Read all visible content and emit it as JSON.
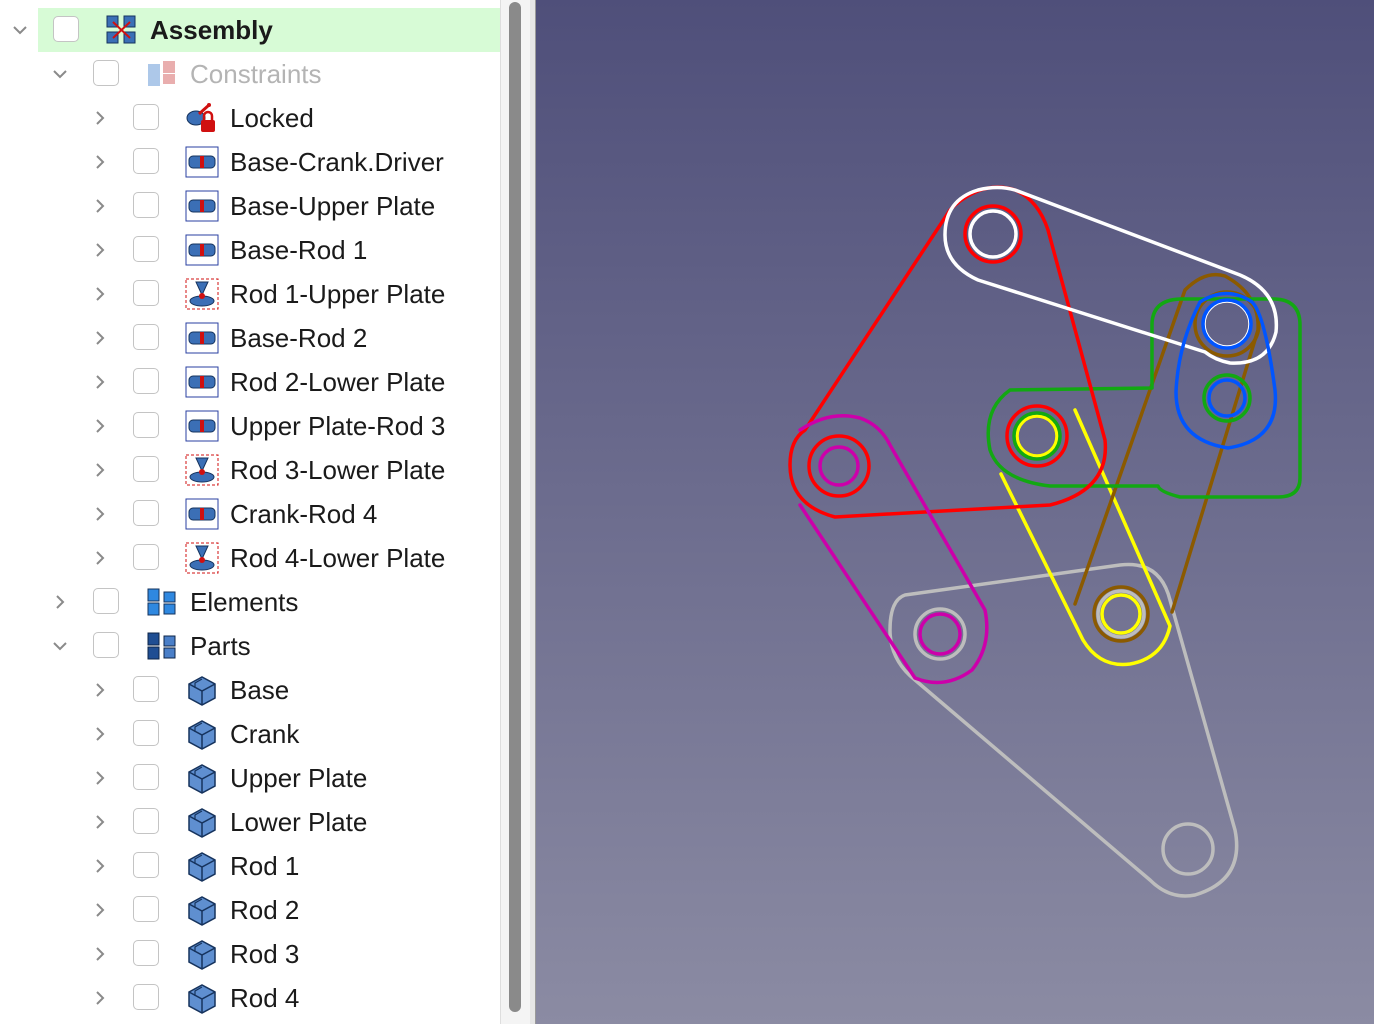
{
  "colors": {
    "selection": "#d7fbd6",
    "viewport_top": "#4f4f7a",
    "viewport_bottom": "#8b8ba3",
    "crank": "#ff0000",
    "upper_plate": "#ffffff",
    "lower_plate": "#bdbdbd",
    "rod1": "#cc00aa",
    "rod2": "#ffff00",
    "rod3": "#8b5a00",
    "rod4": "#0055ff",
    "base": "#12a812"
  },
  "tree": {
    "rows": [
      {
        "label": "Assembly",
        "indent": 0,
        "state": "expanded",
        "icon": "assembly-icon",
        "style": "bold",
        "selected": true
      },
      {
        "label": "Constraints",
        "indent": 1,
        "state": "expanded",
        "icon": "constraints-group-icon",
        "style": "dim"
      },
      {
        "label": "Locked",
        "indent": 2,
        "state": "collapsed",
        "icon": "locked-constraint-icon"
      },
      {
        "label": "Base-Crank.Driver",
        "indent": 2,
        "state": "collapsed",
        "icon": "plane-coincident-icon"
      },
      {
        "label": "Base-Upper Plate",
        "indent": 2,
        "state": "collapsed",
        "icon": "plane-coincident-icon"
      },
      {
        "label": "Base-Rod 1",
        "indent": 2,
        "state": "collapsed",
        "icon": "plane-coincident-icon"
      },
      {
        "label": "Rod 1-Upper Plate",
        "indent": 2,
        "state": "collapsed",
        "icon": "axial-constraint-icon"
      },
      {
        "label": "Base-Rod 2",
        "indent": 2,
        "state": "collapsed",
        "icon": "plane-coincident-icon"
      },
      {
        "label": "Rod 2-Lower Plate",
        "indent": 2,
        "state": "collapsed",
        "icon": "plane-coincident-icon"
      },
      {
        "label": "Upper Plate-Rod 3",
        "indent": 2,
        "state": "collapsed",
        "icon": "plane-coincident-icon"
      },
      {
        "label": "Rod 3-Lower Plate",
        "indent": 2,
        "state": "collapsed",
        "icon": "axial-constraint-icon"
      },
      {
        "label": "Crank-Rod 4",
        "indent": 2,
        "state": "collapsed",
        "icon": "plane-coincident-icon"
      },
      {
        "label": "Rod 4-Lower Plate",
        "indent": 2,
        "state": "collapsed",
        "icon": "axial-constraint-icon"
      },
      {
        "label": "Elements",
        "indent": 1,
        "state": "collapsed",
        "icon": "elements-group-icon"
      },
      {
        "label": "Parts",
        "indent": 1,
        "state": "expanded",
        "icon": "parts-group-icon"
      },
      {
        "label": "Base",
        "indent": 2,
        "state": "collapsed",
        "icon": "part-icon"
      },
      {
        "label": "Crank",
        "indent": 2,
        "state": "collapsed",
        "icon": "part-icon"
      },
      {
        "label": "Upper Plate",
        "indent": 2,
        "state": "collapsed",
        "icon": "part-icon"
      },
      {
        "label": "Lower Plate",
        "indent": 2,
        "state": "collapsed",
        "icon": "part-icon"
      },
      {
        "label": "Rod 1",
        "indent": 2,
        "state": "collapsed",
        "icon": "part-icon"
      },
      {
        "label": "Rod 2",
        "indent": 2,
        "state": "collapsed",
        "icon": "part-icon"
      },
      {
        "label": "Rod 3",
        "indent": 2,
        "state": "collapsed",
        "icon": "part-icon"
      },
      {
        "label": "Rod 4",
        "indent": 2,
        "state": "collapsed",
        "icon": "part-icon"
      }
    ]
  }
}
